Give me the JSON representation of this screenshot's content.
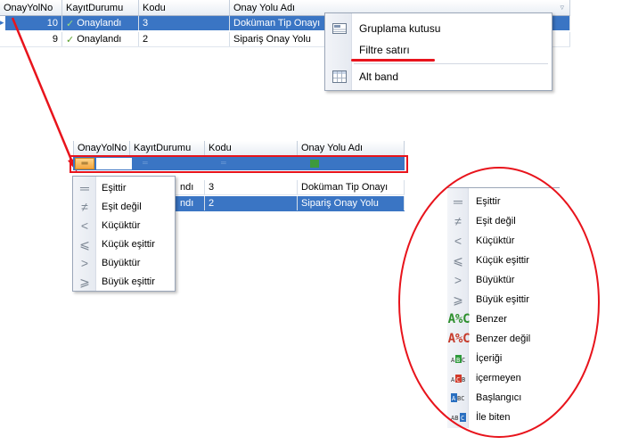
{
  "grid1": {
    "headers": [
      "OnayYolNo",
      "KayıtDurumu",
      "Kodu",
      "Onay Yolu Adı"
    ],
    "rows": [
      {
        "no": "10",
        "status": "Onaylandı",
        "code": "3",
        "name": "Doküman Tip Onayı"
      },
      {
        "no": "9",
        "status": "Onaylandı",
        "code": "2",
        "name": "Sipariş Onay Yolu"
      }
    ]
  },
  "context_menu": {
    "items": [
      "Gruplama kutusu",
      "Filtre satırı",
      "Alt band"
    ]
  },
  "grid2": {
    "headers": [
      "OnayYolNo",
      "KayıtDurumu",
      "Kodu",
      "Onay Yolu Adı"
    ],
    "rows": [
      {
        "status_tail": "ndı",
        "code": "3",
        "name": "Doküman Tip Onayı"
      },
      {
        "status_tail": "ndı",
        "code": "2",
        "name": "Sipariş Onay Yolu"
      }
    ]
  },
  "operator_menu": {
    "items": [
      "Eşittir",
      "Eşit değil",
      "Küçüktür",
      "Küçük eşittir",
      "Büyüktür",
      "Büyük eşittir"
    ]
  },
  "full_operator_menu": {
    "items": [
      "Eşittir",
      "Eşit değil",
      "Küçüktür",
      "Küçük eşittir",
      "Büyüktür",
      "Büyük eşittir",
      "Benzer",
      "Benzer değil",
      "İçeriği",
      "içermeyen",
      "Başlangıcı",
      "İle biten"
    ],
    "icon_tags": [
      "A%C",
      "A%C",
      "ABC",
      "ABC",
      "ABC",
      "ABC"
    ]
  },
  "colors": {
    "selection": "#3a75c4",
    "annotation": "#e8141c",
    "check": "#5aa02c"
  }
}
